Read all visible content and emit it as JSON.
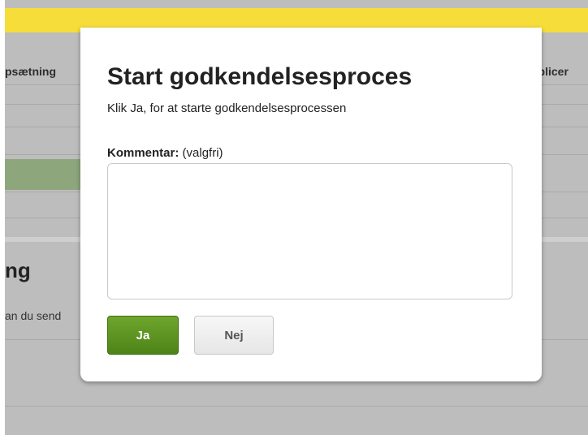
{
  "background": {
    "header_left": "psætning",
    "header_right": "ublicer",
    "section_title": "ng",
    "section_text": "an du send"
  },
  "dialog": {
    "title": "Start godkendelsesproces",
    "description": "Klik Ja, for at starte godkendelsesprocessen",
    "comment_label": "Kommentar:",
    "comment_hint": "(valgfri)",
    "comment_value": "",
    "yes_label": "Ja",
    "no_label": "Nej"
  },
  "colors": {
    "accent_yellow": "#f7dd3a",
    "primary_green": "#5b9421",
    "overlay_gray": "#bdbdbd"
  }
}
